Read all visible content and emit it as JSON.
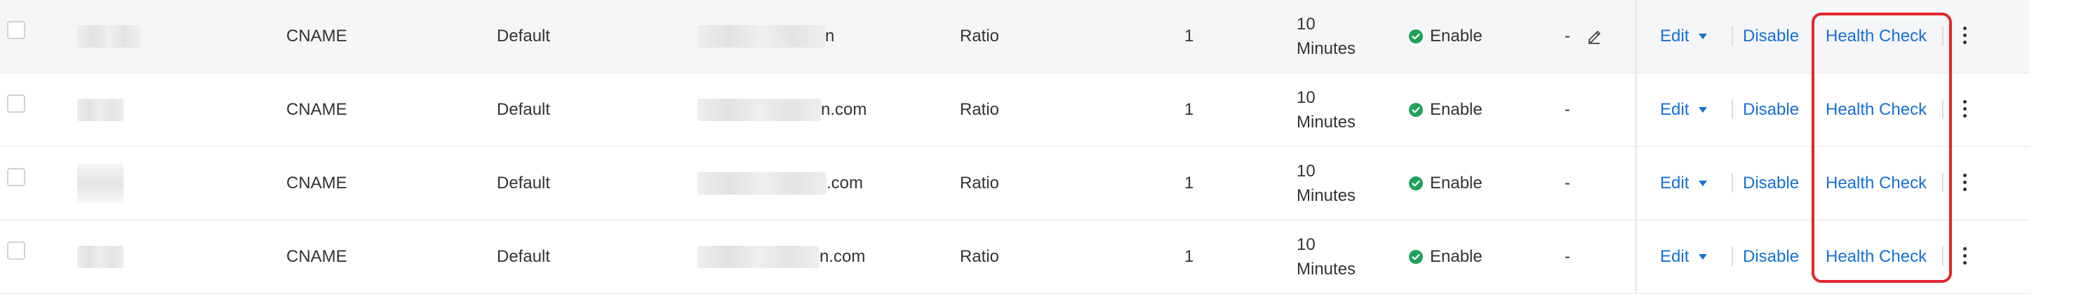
{
  "colors": {
    "link": "#1670d4",
    "enabled_status": "#22a05b",
    "highlight": "#e1262c",
    "row_hover": "#f5f6f8"
  },
  "actions": {
    "edit": "Edit",
    "disable": "Disable",
    "health_check": "Health Check"
  },
  "rows": [
    {
      "type": "CNAME",
      "line": "Default",
      "value_suffix": "n",
      "schedule": "Ratio",
      "weight": "1",
      "ttl_number": "10",
      "ttl_unit": "Minutes",
      "status": "Enable",
      "remark": "-"
    },
    {
      "type": "CNAME",
      "line": "Default",
      "value_suffix": "n.com",
      "schedule": "Ratio",
      "weight": "1",
      "ttl_number": "10",
      "ttl_unit": "Minutes",
      "status": "Enable",
      "remark": "-"
    },
    {
      "type": "CNAME",
      "line": "Default",
      "value_suffix": ".com",
      "schedule": "Ratio",
      "weight": "1",
      "ttl_number": "10",
      "ttl_unit": "Minutes",
      "status": "Enable",
      "remark": "-"
    },
    {
      "type": "CNAME",
      "line": "Default",
      "value_suffix": "n.com",
      "schedule": "Ratio",
      "weight": "1",
      "ttl_number": "10",
      "ttl_unit": "Minutes",
      "status": "Enable",
      "remark": "-"
    }
  ],
  "icons": {
    "status": "check-circle-icon",
    "edit_remark": "pencil-icon",
    "edit_dropdown": "caret-down-icon",
    "more": "more-vertical-icon"
  }
}
